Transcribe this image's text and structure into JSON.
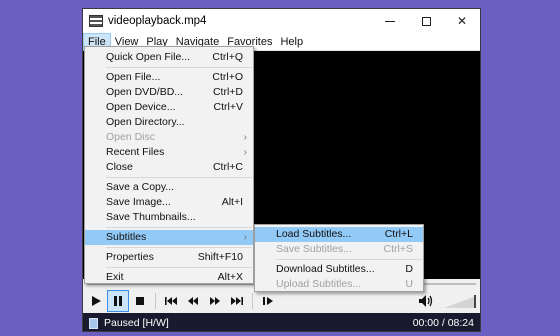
{
  "window": {
    "title": "videoplayback.mp4",
    "buttons": {
      "minimize": "—",
      "maximize": "",
      "close": "✕"
    }
  },
  "menubar": [
    "File",
    "View",
    "Play",
    "Navigate",
    "Favorites",
    "Help"
  ],
  "file_menu": {
    "quick_open": {
      "label": "Quick Open File...",
      "shortcut": "Ctrl+Q"
    },
    "open_file": {
      "label": "Open File...",
      "shortcut": "Ctrl+O"
    },
    "open_dvd": {
      "label": "Open DVD/BD...",
      "shortcut": "Ctrl+D"
    },
    "open_device": {
      "label": "Open Device...",
      "shortcut": "Ctrl+V"
    },
    "open_directory": {
      "label": "Open Directory...",
      "shortcut": ""
    },
    "open_disc": {
      "label": "Open Disc",
      "shortcut": ""
    },
    "recent_files": {
      "label": "Recent Files",
      "shortcut": ""
    },
    "close": {
      "label": "Close",
      "shortcut": "Ctrl+C"
    },
    "save_copy": {
      "label": "Save a Copy...",
      "shortcut": ""
    },
    "save_image": {
      "label": "Save Image...",
      "shortcut": "Alt+I"
    },
    "save_thumbnails": {
      "label": "Save Thumbnails...",
      "shortcut": ""
    },
    "subtitles": {
      "label": "Subtitles",
      "shortcut": ""
    },
    "properties": {
      "label": "Properties",
      "shortcut": "Shift+F10"
    },
    "exit": {
      "label": "Exit",
      "shortcut": "Alt+X"
    }
  },
  "subtitles_menu": {
    "load": {
      "label": "Load Subtitles...",
      "shortcut": "Ctrl+L"
    },
    "save": {
      "label": "Save Subtitles...",
      "shortcut": "Ctrl+S"
    },
    "download": {
      "label": "Download Subtitles...",
      "shortcut": "D"
    },
    "upload": {
      "label": "Upload Subtitles...",
      "shortcut": "U"
    }
  },
  "controls": {
    "play": "play-icon",
    "pause": "pause-icon",
    "stop": "stop-icon",
    "prev": "skip-previous-icon",
    "rewind": "rewind-icon",
    "forward": "fast-forward-icon",
    "next": "skip-next-icon",
    "frame_step": "frame-step-icon",
    "volume": "speaker-icon"
  },
  "status": {
    "text": "Paused [H/W]",
    "time": "00:00 / 08:24"
  },
  "colors": {
    "desktop": "#6b5fc3",
    "menu_highlight": "#91c9f7",
    "active_menu": "#cce4f7"
  }
}
